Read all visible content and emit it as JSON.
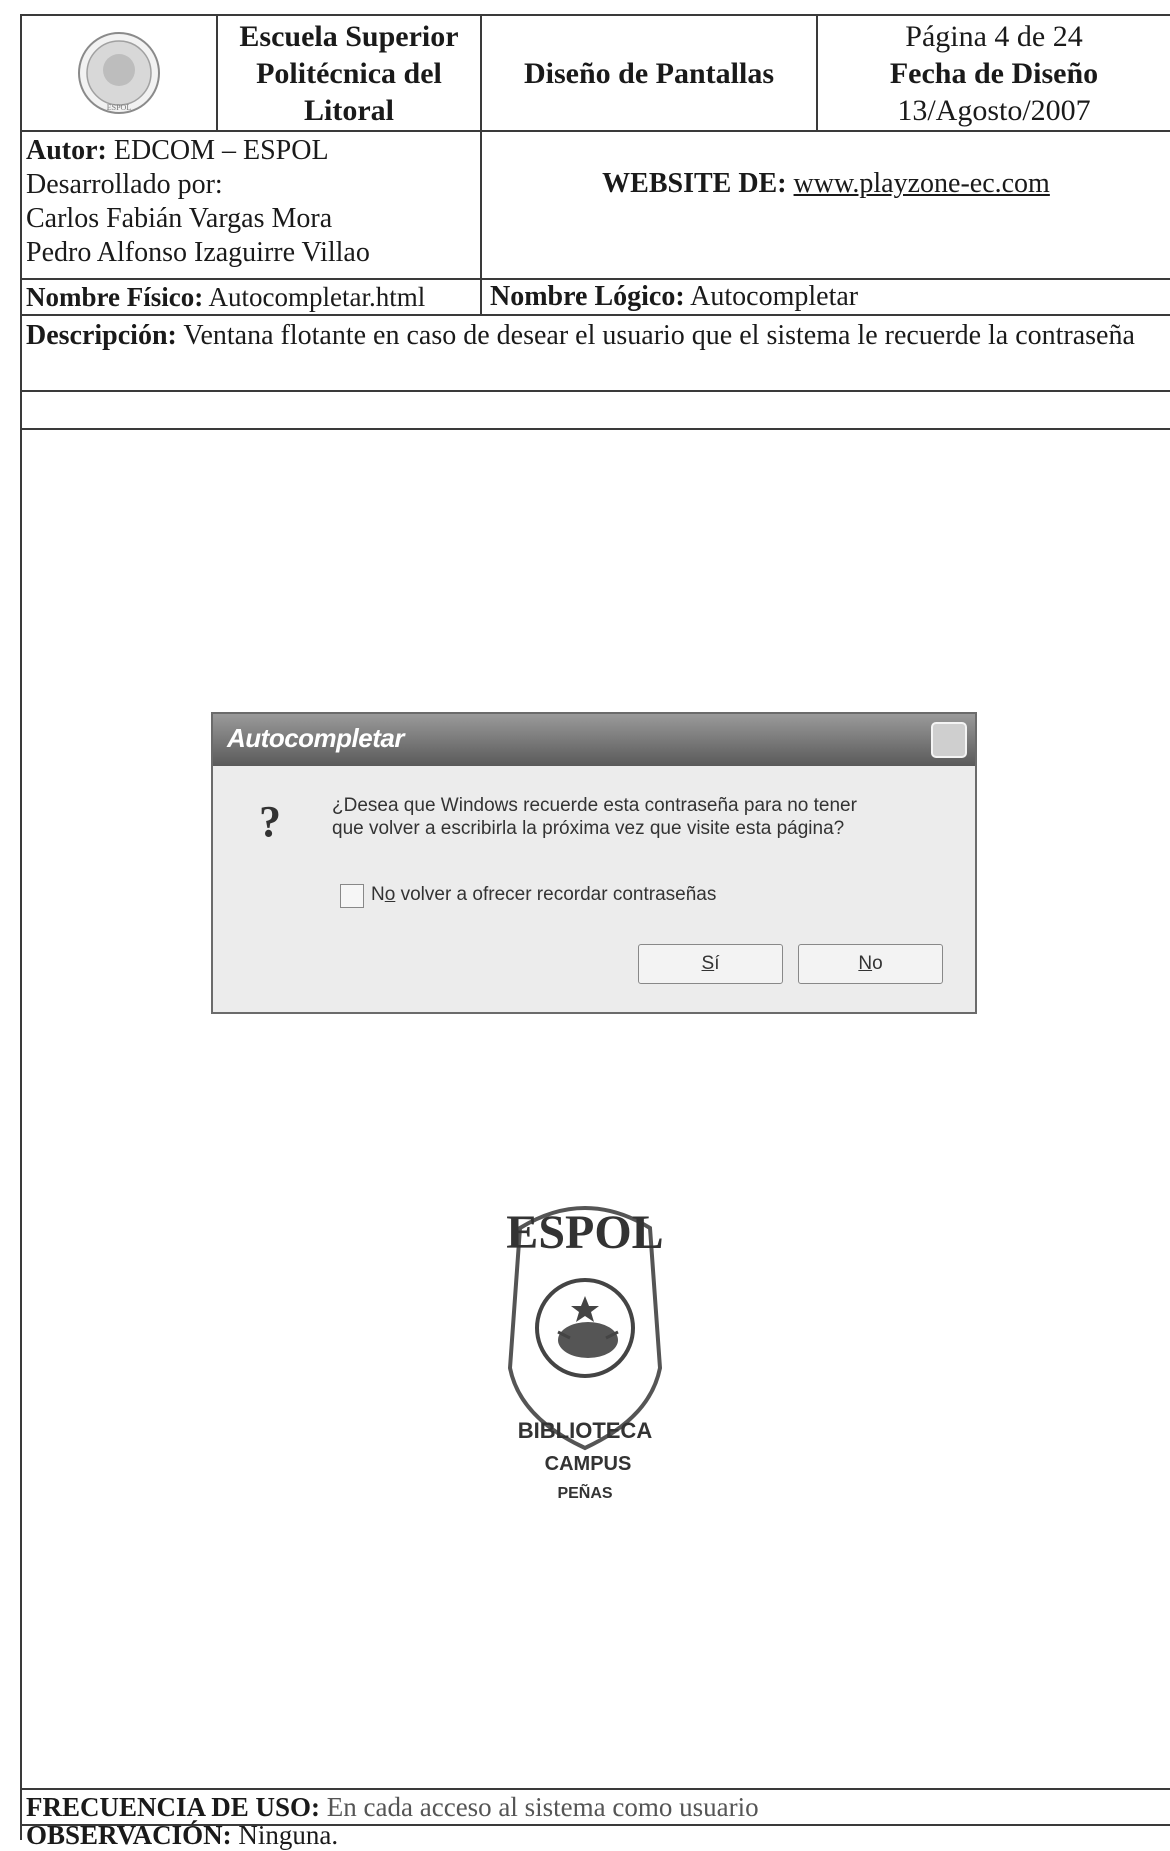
{
  "header": {
    "institution": [
      "Escuela Superior",
      "Politécnica del",
      "Litoral"
    ],
    "document_title": "Diseño de Pantallas",
    "page": "Página 4 de 24",
    "date_label": "Fecha de Diseño",
    "date_value": "13/Agosto/2007",
    "logo_text": "ESPOL"
  },
  "author": {
    "label": "Autor:",
    "value": "EDCOM – ESPOL",
    "developed_by": "Desarrollado por:",
    "developers": [
      "Carlos Fabián Vargas Mora",
      "Pedro Alfonso Izaguirre Villao"
    ]
  },
  "website": {
    "label": "WEBSITE DE:",
    "url": "www.playzone-ec.com"
  },
  "names": {
    "physical_label": "Nombre Físico:",
    "physical_value": "Autocompletar.html",
    "logical_label": "Nombre Lógico:",
    "logical_value": "Autocompletar"
  },
  "description": {
    "label": "Descripción:",
    "text": "Ventana flotante en caso de desear el usuario que el sistema le recuerde la contraseña"
  },
  "dialog": {
    "title": "Autocompletar",
    "icon": "question-icon",
    "message_line1": "¿Desea que Windows recuerde esta contraseña para no tener",
    "message_line2": "que volver a escribirla la próxima vez que visite esta página?",
    "checkbox_label_pre": "N",
    "checkbox_label_u": "o",
    "checkbox_label_post": " volver a ofrecer recordar contraseñas",
    "checkbox_checked": false,
    "yes_u": "S",
    "yes_rest": "í",
    "no_u": "N",
    "no_rest": "o"
  },
  "stamp": {
    "top": "ESPOL",
    "library": "BIBLIOTECA",
    "campus": "CAMPUS",
    "place": "PEÑAS"
  },
  "footer": {
    "frequency_label": "FRECUENCIA DE USO:",
    "frequency_value": "En cada acceso al sistema como usuario",
    "observation_label": "OBSERVACIÓN:",
    "observation_value": "Ninguna."
  }
}
